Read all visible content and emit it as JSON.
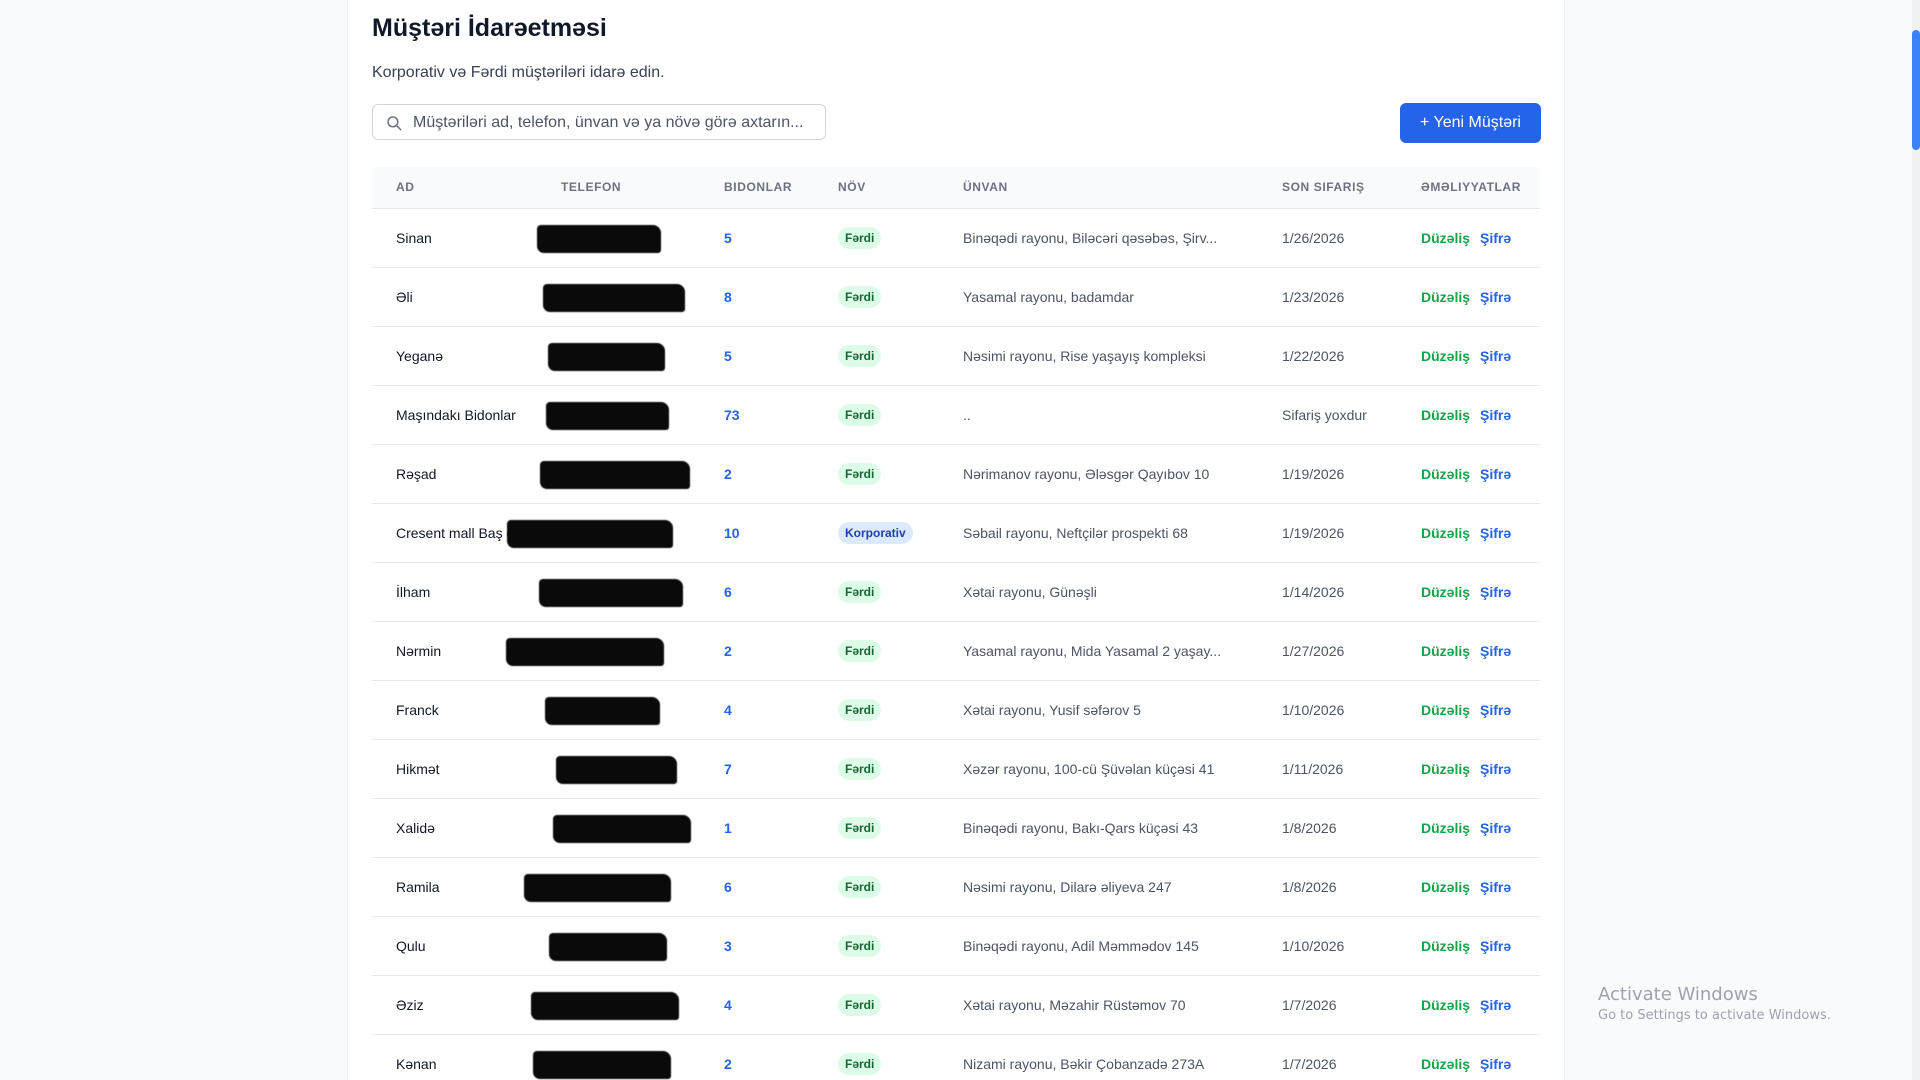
{
  "page": {
    "title": "Müştəri İdarəetməsi",
    "subtitle": "Korporativ və Fərdi müştəriləri idarə edin."
  },
  "search": {
    "placeholder": "Müştəriləri ad, telefon, ünvan və ya növə görə axtarın...",
    "value": ""
  },
  "toolbar": {
    "new_customer_label": "+ Yeni Müştəri"
  },
  "table": {
    "columns": [
      "AD",
      "TELEFON",
      "BIDONLAR",
      "NÖV",
      "ÜNVAN",
      "SON SIFARIŞ",
      "ƏMƏLIYYATLAR"
    ],
    "actions": {
      "edit": "Düzəliş",
      "password": "Şifrə"
    },
    "rows": [
      {
        "name": "Sinan",
        "phone": "",
        "bidonlar": "5",
        "type": "Fərdi",
        "address": "Binəqədi rayonu, Biləcəri qəsəbəs, Şirv...",
        "last_order": "1/26/2026"
      },
      {
        "name": "Əli",
        "phone": "",
        "bidonlar": "8",
        "type": "Fərdi",
        "address": "Yasamal rayonu, badamdar",
        "last_order": "1/23/2026"
      },
      {
        "name": "Yeganə",
        "phone": "",
        "bidonlar": "5",
        "type": "Fərdi",
        "address": "Nəsimi rayonu, Rise yaşayış kompleksi",
        "last_order": "1/22/2026"
      },
      {
        "name": "Maşındakı Bidonlar",
        "phone": "",
        "bidonlar": "73",
        "type": "Fərdi",
        "address": "..",
        "last_order": "Sifariş yoxdur"
      },
      {
        "name": "Rəşad",
        "phone": "",
        "bidonlar": "2",
        "type": "Fərdi",
        "address": "Nərimanov rayonu, Ələsgər Qayıbov 10",
        "last_order": "1/19/2026"
      },
      {
        "name": "Cresent mall Baş ofis",
        "phone": "",
        "bidonlar": "10",
        "type": "Korporativ",
        "address": "Səbail rayonu, Neftçilər prospekti 68",
        "last_order": "1/19/2026"
      },
      {
        "name": "İlham",
        "phone": "",
        "bidonlar": "6",
        "type": "Fərdi",
        "address": "Xətai rayonu, Günəşli",
        "last_order": "1/14/2026"
      },
      {
        "name": "Nərmin",
        "phone": "",
        "bidonlar": "2",
        "type": "Fərdi",
        "address": "Yasamal rayonu, Mida Yasamal 2 yaşay...",
        "last_order": "1/27/2026"
      },
      {
        "name": "Franck",
        "phone": "",
        "bidonlar": "4",
        "type": "Fərdi",
        "address": "Xətai rayonu, Yusif səfərov 5",
        "last_order": "1/10/2026"
      },
      {
        "name": "Hikmət",
        "phone": "",
        "bidonlar": "7",
        "type": "Fərdi",
        "address": "Xəzər rayonu, 100-cü Şüvəlan küçəsi 41",
        "last_order": "1/11/2026"
      },
      {
        "name": "Xalidə",
        "phone": "",
        "bidonlar": "1",
        "type": "Fərdi",
        "address": "Binəqədi rayonu, Bakı-Qars küçəsi 43",
        "last_order": "1/8/2026"
      },
      {
        "name": "Ramila",
        "phone": "",
        "bidonlar": "6",
        "type": "Fərdi",
        "address": "Nəsimi rayonu, Dilarə əliyeva 247",
        "last_order": "1/8/2026"
      },
      {
        "name": "Qulu",
        "phone": "",
        "bidonlar": "3",
        "type": "Fərdi",
        "address": "Binəqədi rayonu, Adil Məmmədov 145",
        "last_order": "1/10/2026"
      },
      {
        "name": "Əziz",
        "phone": "",
        "bidonlar": "4",
        "type": "Fərdi",
        "address": "Xətai rayonu, Məzahir Rüstəmov 70",
        "last_order": "1/7/2026"
      },
      {
        "name": "Kənan",
        "phone": "",
        "bidonlar": "2",
        "type": "Fərdi",
        "address": "Nizami rayonu, Bəkir Çobanzadə 273A",
        "last_order": "1/7/2026"
      }
    ]
  },
  "watermark": {
    "line1": "Activate Windows",
    "line2": "Go to Settings to activate Windows."
  },
  "colors": {
    "accent": "#2563eb",
    "edit_action": "#16a34a",
    "badge_ferdi_bg": "#dcfce7",
    "badge_korporativ_bg": "#dbeafe"
  },
  "icons": {
    "search": "search-icon"
  }
}
